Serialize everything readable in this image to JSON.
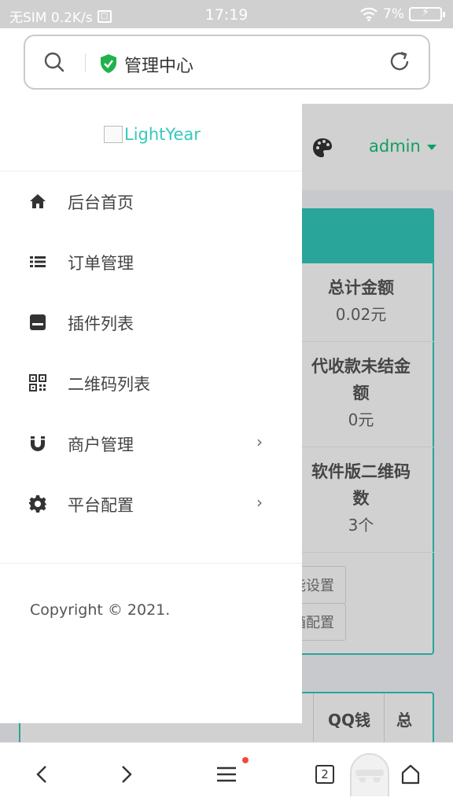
{
  "status_bar": {
    "carrier": "无SIM 0.2K/s",
    "time": "17:19",
    "battery": "7%"
  },
  "browser": {
    "address_title": "管理中心",
    "tab_count": "2"
  },
  "page": {
    "admin_label": "admin",
    "stats": [
      {
        "label": "总计金额",
        "value": "0.02元"
      },
      {
        "label_line1": "代收款未结金",
        "label_line2": "额",
        "value": "0元"
      },
      {
        "label_line1": "软件版二维码",
        "label_line2": "数",
        "value": "3个"
      }
    ],
    "buttons": [
      "能设置",
      "箱配置"
    ],
    "table_headers": [
      "QQ钱",
      "总"
    ],
    "accent_color": "#33cabb"
  },
  "sidebar": {
    "logo_alt": "LightYear",
    "items": [
      {
        "label": "后台首页",
        "icon": "home-icon"
      },
      {
        "label": "订单管理",
        "icon": "list-icon"
      },
      {
        "label": "插件列表",
        "icon": "plugin-icon"
      },
      {
        "label": "二维码列表",
        "icon": "qrcode-icon"
      },
      {
        "label": "商户管理",
        "icon": "magnet-icon",
        "arrow": "›"
      },
      {
        "label": "平台配置",
        "icon": "gear-icon",
        "arrow": "›"
      }
    ],
    "copyright": "Copyright © 2021."
  }
}
